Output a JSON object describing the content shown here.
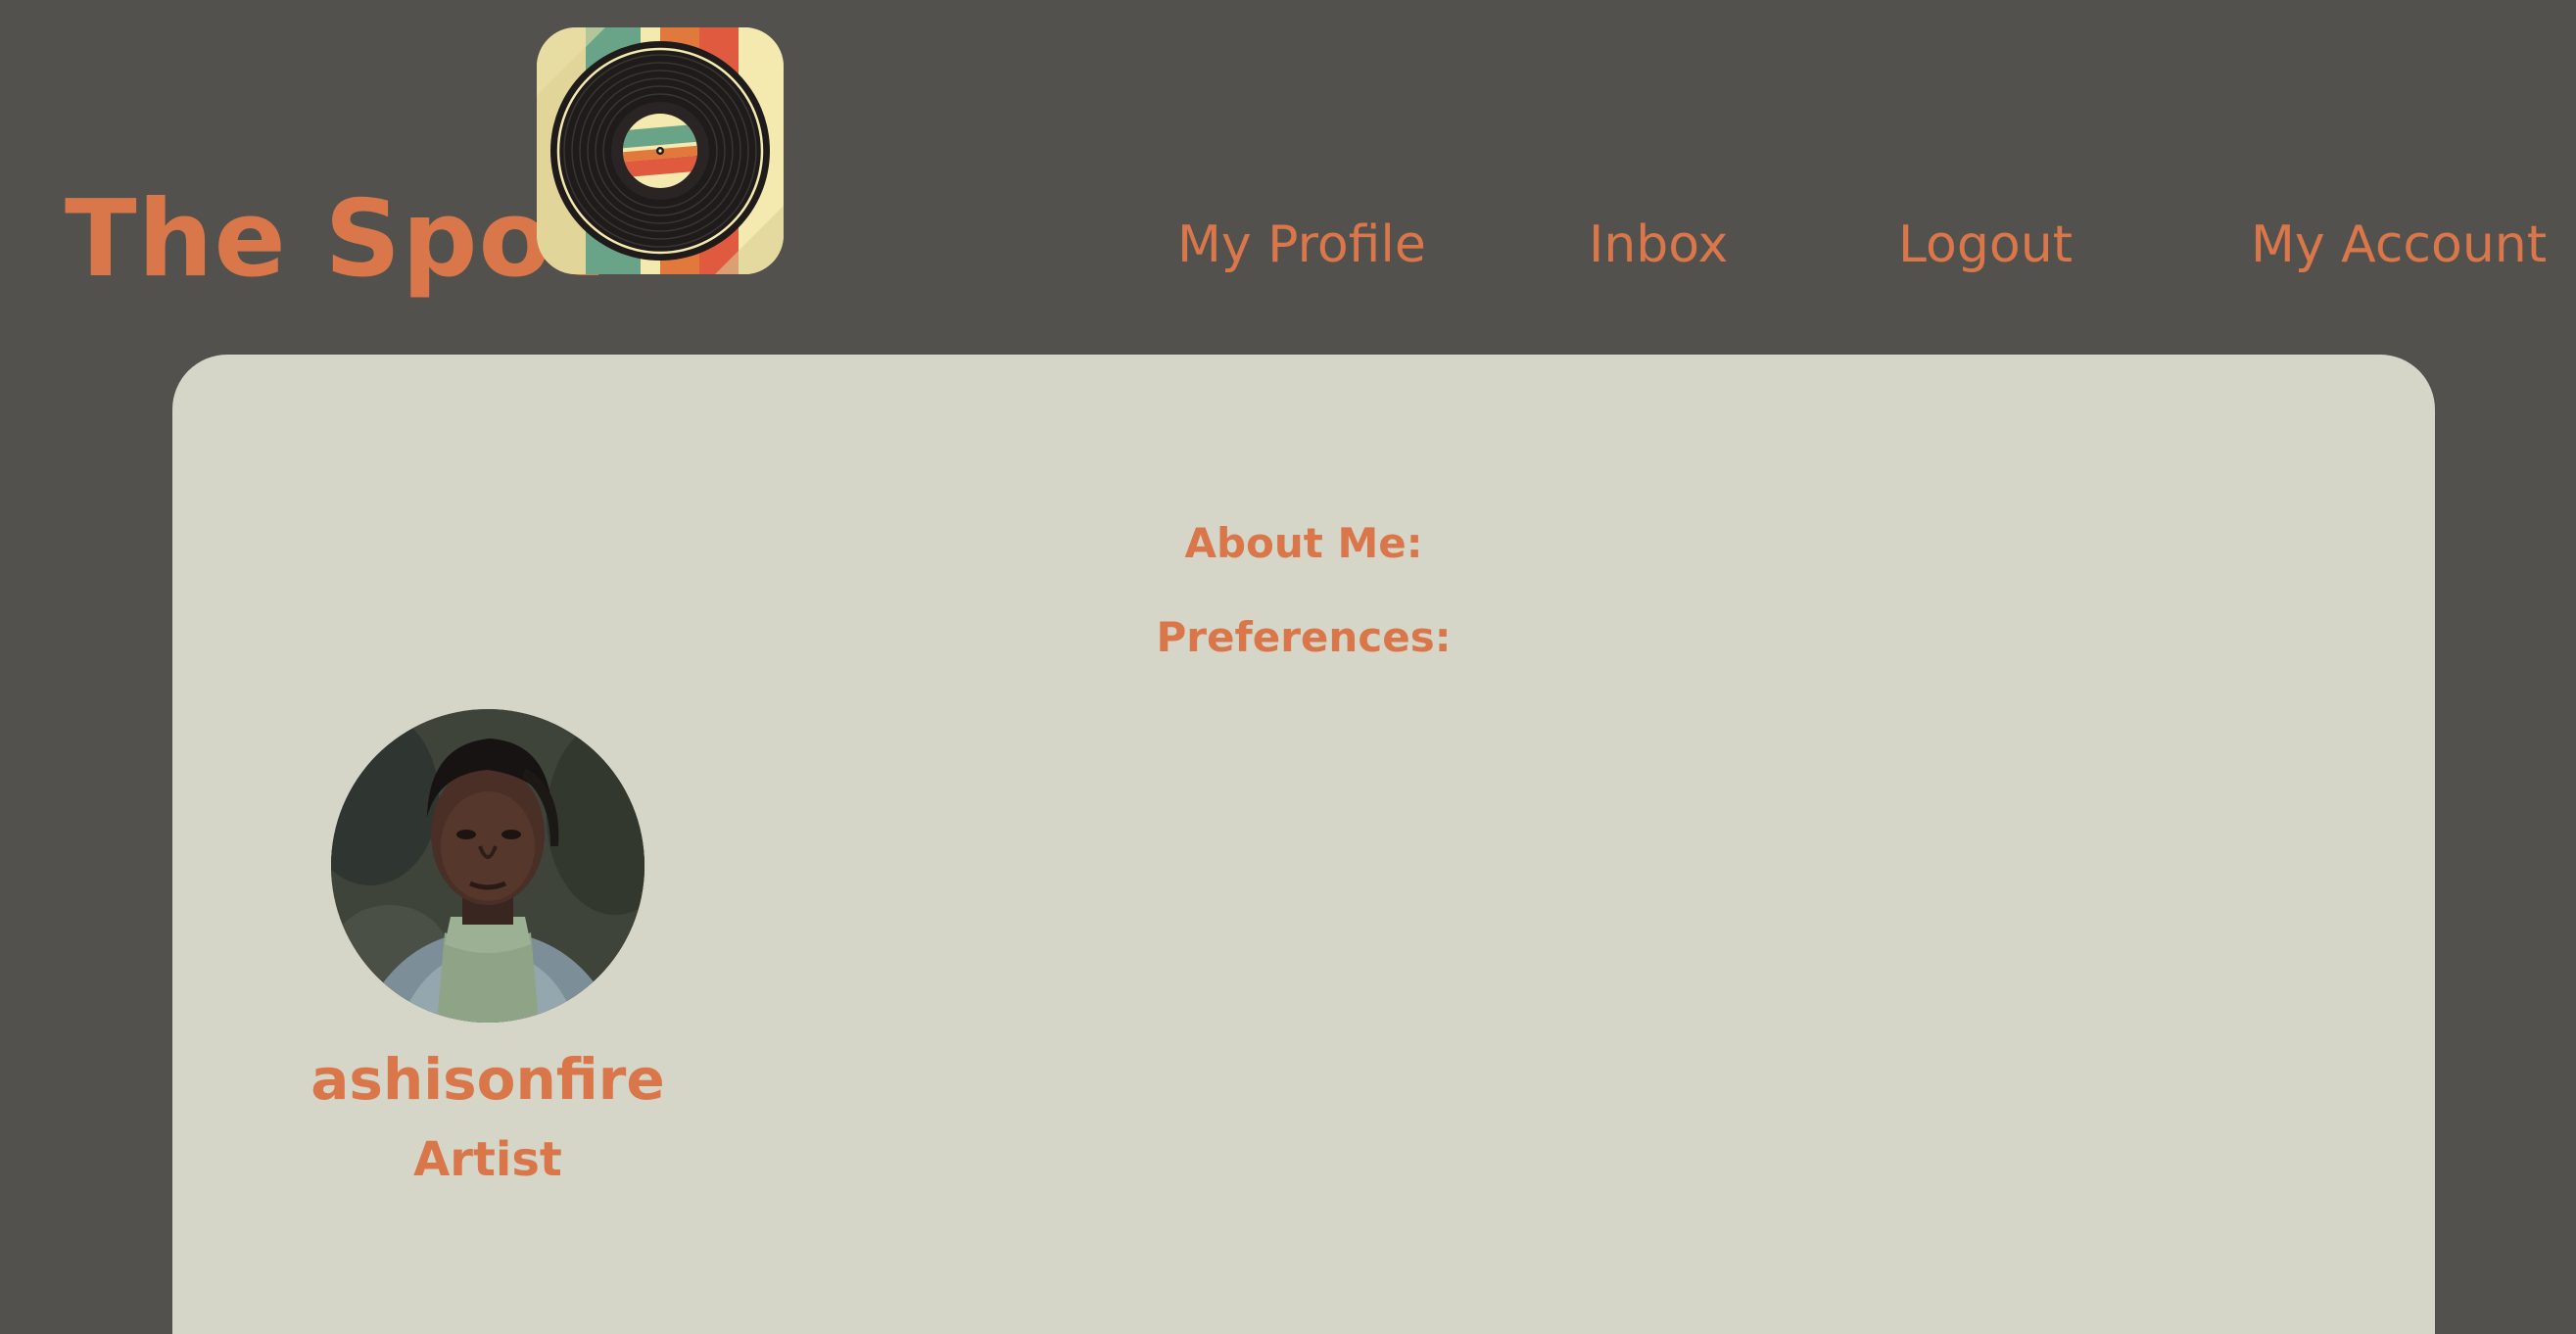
{
  "brand": {
    "title": "The Spot",
    "logo_icon": "vinyl-record-icon"
  },
  "nav": {
    "items": [
      {
        "label": "My Profile"
      },
      {
        "label": "Inbox"
      },
      {
        "label": "Logout"
      },
      {
        "label": "My Account"
      }
    ]
  },
  "profile": {
    "about_label": "About Me:",
    "preferences_label": "Preferences:",
    "avatar_icon": "profile-photo",
    "username": "ashisonfire",
    "role": "Artist"
  },
  "colors": {
    "background": "#53514d",
    "card": "#d6d6c8",
    "accent": "#d9774a"
  }
}
